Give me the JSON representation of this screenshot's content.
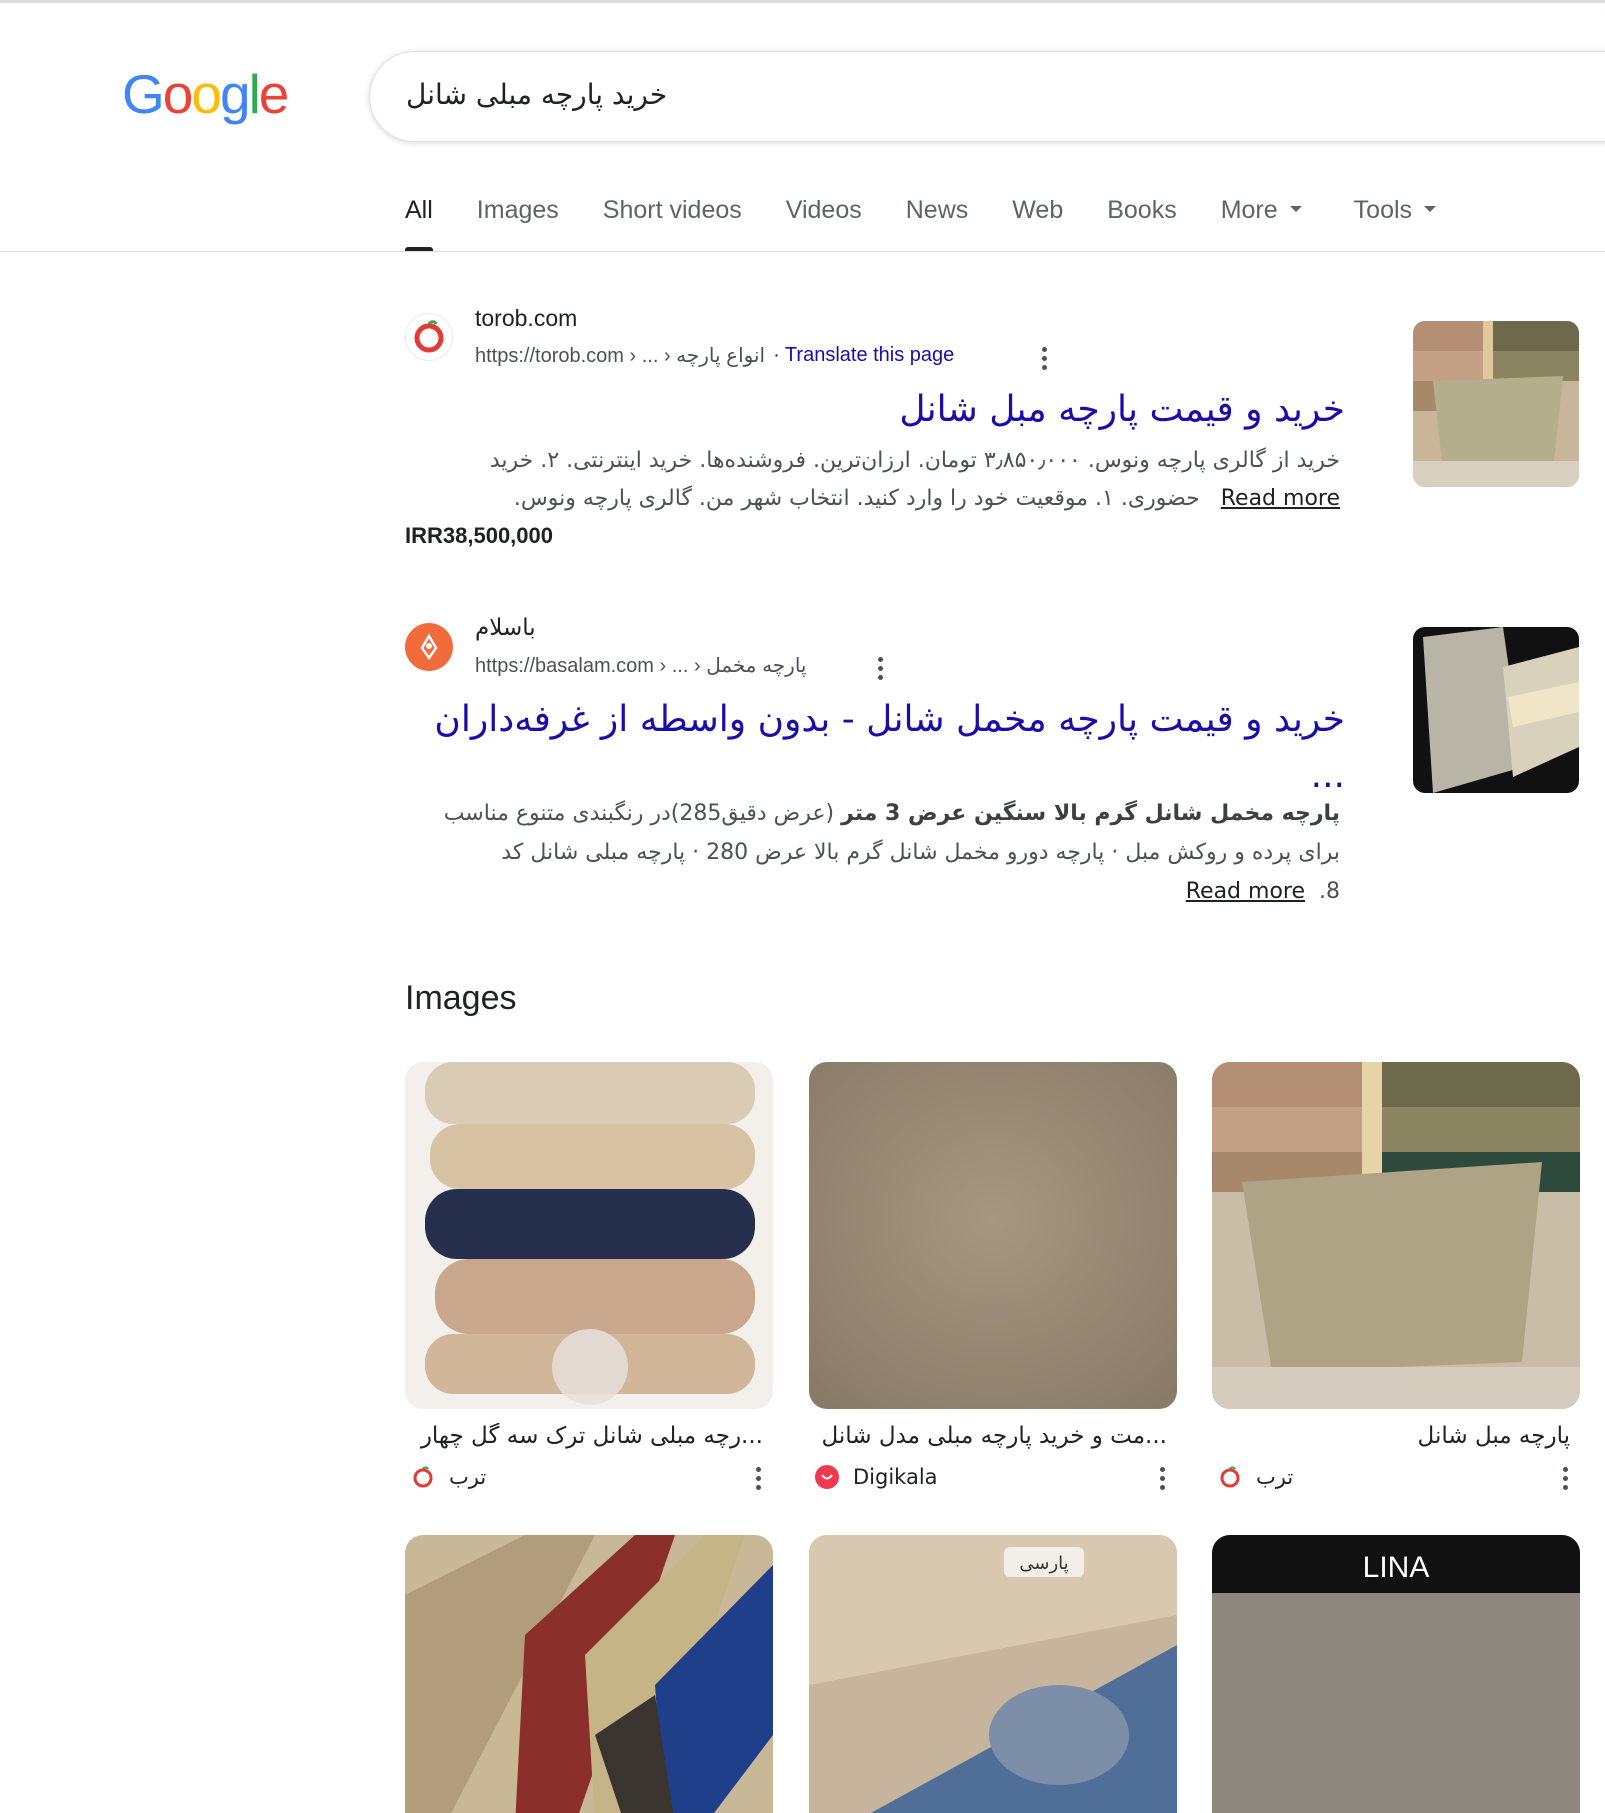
{
  "logo": {
    "letters": [
      "G",
      "o",
      "o",
      "g",
      "l",
      "e"
    ],
    "colors": [
      "#4285F4",
      "#EA4335",
      "#FBBC05",
      "#4285F4",
      "#34A853",
      "#EA4335"
    ]
  },
  "search": {
    "query": "خرید پارچه مبلی شانل"
  },
  "tabs": [
    {
      "label": "All",
      "active": true
    },
    {
      "label": "Images"
    },
    {
      "label": "Short videos"
    },
    {
      "label": "Videos"
    },
    {
      "label": "News"
    },
    {
      "label": "Web"
    },
    {
      "label": "Books"
    },
    {
      "label": "More"
    },
    {
      "label": "Tools"
    }
  ],
  "results": [
    {
      "site_name": "torob.com",
      "url": "https://torob.com › ... › انواع پارچه",
      "translate": "· Translate this page",
      "title": "خرید و قیمت پارچه مبل شانل",
      "snippet_line1": "خرید از گالری پارچه ونوس. ۳٫۸۵۰٫۰۰۰ تومان. ارزان‌ترین. فروشنده‌ها. خرید اینترنتی. ۲. خرید",
      "snippet_line2": "حضوری. ۱. موقعیت خود را وارد کنید. انتخاب شهر من. گالری پارچه ونوس.",
      "read_more": "Read more",
      "price": "IRR38,500,000"
    },
    {
      "site_name": "باسلام",
      "url": "https://basalam.com › ... › پارچه مخمل",
      "title": "خرید و قیمت پارچه مخمل شانل - بدون واسطه از غرفه‌داران ...",
      "snippet_bold": "پارچه مخمل شانل گرم بالا سنگین عرض 3 متر",
      "snippet_rest": " (عرض دقیق285)در رنگبندی متنوع مناسب برای پرده و روکش مبل · پارچه دورو مخمل شانل گرم بالا عرض 280 · پارچه مبلی شانل کد 8.",
      "read_more": "Read more"
    }
  ],
  "images_section": {
    "heading": "Images",
    "items": [
      {
        "caption": "...رچه مبلی شانل ترک سه گل چهار",
        "source": "ترب"
      },
      {
        "caption": "...مت و خرید پارچه مبلی مدل شانل",
        "source": "Digikala"
      },
      {
        "caption": "پارچه مبل شانل",
        "source": "ترب"
      },
      {
        "label": ""
      },
      {
        "label": "پارسی"
      },
      {
        "label": "LINA"
      }
    ]
  },
  "colors": {
    "link": "#1a0dab",
    "torob": "#e53935",
    "digikala": "#ef394e",
    "basalam": "#f26b3a"
  }
}
